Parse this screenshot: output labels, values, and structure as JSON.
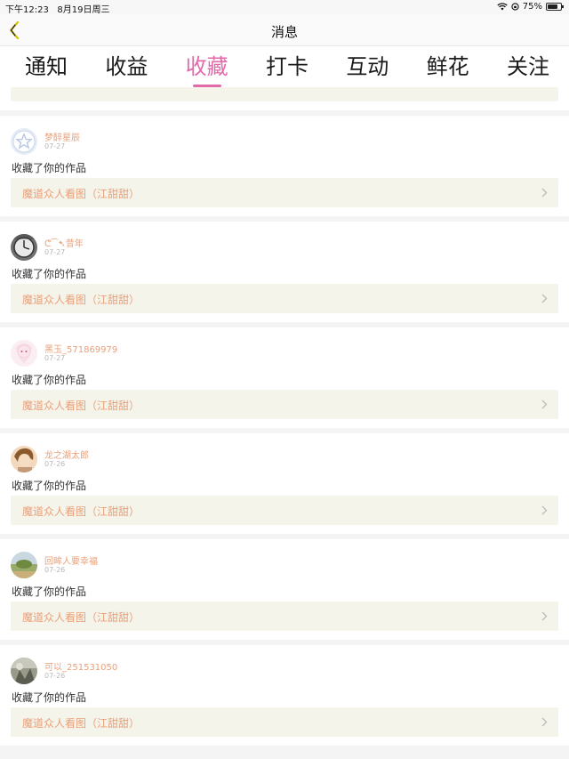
{
  "status_bar": {
    "time": "下午12:23",
    "date": "8月19日周三",
    "battery": "75%",
    "battery_level": 0.75
  },
  "nav": {
    "title": "消息",
    "back_icon": "chevron-left-icon",
    "accent": "#d7c416"
  },
  "tabs": [
    {
      "label": "通知",
      "active": false
    },
    {
      "label": "收益",
      "active": false
    },
    {
      "label": "收藏",
      "active": true
    },
    {
      "label": "打卡",
      "active": false
    },
    {
      "label": "互动",
      "active": false
    },
    {
      "label": "鲜花",
      "active": false
    },
    {
      "label": "关注",
      "active": false
    }
  ],
  "colors": {
    "active_tab": "#e36aa9",
    "username": "#e8a07a",
    "work_link_bg": "#f5f4ea"
  },
  "notifications": [
    {
      "name": "梦醉星辰",
      "date": "07-27",
      "action": "收藏了你的作品",
      "work": "魔道众人看图（江甜甜）",
      "avatar": "default-star-avatar"
    },
    {
      "name": "ᕦ⁀➷昔年",
      "date": "07-27",
      "action": "收藏了你的作品",
      "work": "魔道众人看图（江甜甜）",
      "avatar": "clock-avatar"
    },
    {
      "name": "黑玉_571869979",
      "date": "07-27",
      "action": "收藏了你的作品",
      "work": "魔道众人看图（江甜甜）",
      "avatar": "anime-girl-avatar"
    },
    {
      "name": "龙之湖太郎",
      "date": "07-26",
      "action": "收藏了你的作品",
      "work": "魔道众人看图（江甜甜）",
      "avatar": "portrait-avatar"
    },
    {
      "name": "回眸人要幸福",
      "date": "07-26",
      "action": "收藏了你的作品",
      "work": "魔道众人看图（江甜甜）",
      "avatar": "landscape-avatar"
    },
    {
      "name": "可以_251531050",
      "date": "07-26",
      "action": "收藏了你的作品",
      "work": "魔道众人看图（江甜甜）",
      "avatar": "photo-avatar"
    }
  ]
}
